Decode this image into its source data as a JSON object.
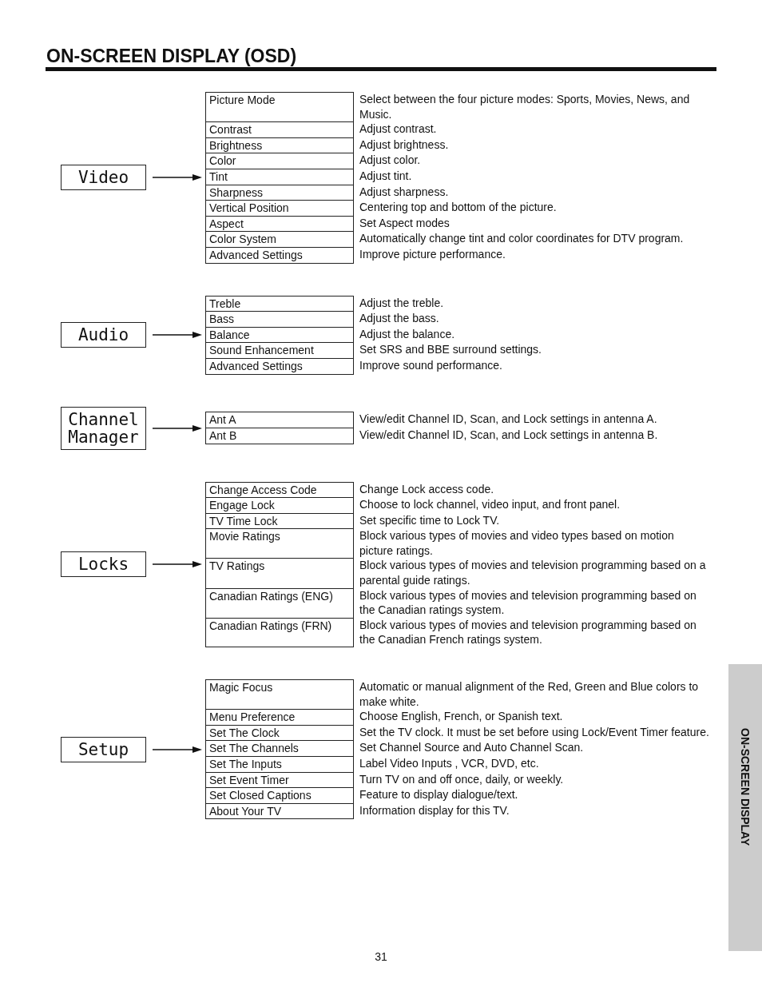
{
  "page_title": "ON-SCREEN DISPLAY (OSD)",
  "sections": [
    {
      "menu": "Video",
      "items": [
        {
          "name": "Picture Mode",
          "description": "Select between the four picture modes: Sports, Movies, News, and Music."
        },
        {
          "name": "Contrast",
          "description": "Adjust contrast."
        },
        {
          "name": "Brightness",
          "description": "Adjust brightness."
        },
        {
          "name": "Color",
          "description": "Adjust color."
        },
        {
          "name": "Tint",
          "description": "Adjust tint."
        },
        {
          "name": "Sharpness",
          "description": "Adjust sharpness."
        },
        {
          "name": "Vertical Position",
          "description": "Centering top and bottom of the picture."
        },
        {
          "name": "Aspect",
          "description": "Set Aspect modes"
        },
        {
          "name": "Color System",
          "description": "Automatically change tint and color coordinates for DTV program."
        },
        {
          "name": "Advanced Settings",
          "description": "Improve picture performance."
        }
      ]
    },
    {
      "menu": "Audio",
      "items": [
        {
          "name": "Treble",
          "description": "Adjust the treble."
        },
        {
          "name": "Bass",
          "description": "Adjust the bass."
        },
        {
          "name": "Balance",
          "description": "Adjust the balance."
        },
        {
          "name": "Sound Enhancement",
          "description": "Set SRS and BBE surround settings."
        },
        {
          "name": "Advanced Settings",
          "description": "Improve sound performance."
        }
      ]
    },
    {
      "menu": "Channel Manager",
      "items": [
        {
          "name": "Ant A",
          "description": "View/edit Channel ID, Scan, and Lock settings in antenna A."
        },
        {
          "name": "Ant B",
          "description": "View/edit Channel ID, Scan, and Lock settings in antenna B."
        }
      ]
    },
    {
      "menu": "Locks",
      "items": [
        {
          "name": "Change Access Code",
          "description": "Change Lock access code."
        },
        {
          "name": "Engage Lock",
          "description": "Choose to lock channel, video input, and front panel."
        },
        {
          "name": "TV Time Lock",
          "description": "Set specific time to Lock TV."
        },
        {
          "name": "Movie Ratings",
          "description": "Block various types of movies and video types based on motion picture ratings."
        },
        {
          "name": "TV Ratings",
          "description": "Block various types of movies and television programming based on a parental guide ratings."
        },
        {
          "name": "Canadian Ratings (ENG)",
          "description": "Block various types of movies and television programming based on the Canadian ratings system."
        },
        {
          "name": "Canadian Ratings (FRN)",
          "description": "Block various types of movies and television programming based on the Canadian French ratings system."
        }
      ]
    },
    {
      "menu": "Setup",
      "items": [
        {
          "name": "Magic Focus",
          "description": "Automatic or manual alignment of the Red, Green and Blue colors to make white."
        },
        {
          "name": "Menu Preference",
          "description": "Choose English, French, or Spanish text."
        },
        {
          "name": "Set The Clock",
          "description": "Set the TV clock. It must be set before using Lock/Event Timer feature."
        },
        {
          "name": "Set The Channels",
          "description": "Set Channel Source and Auto Channel Scan."
        },
        {
          "name": "Set The Inputs",
          "description": "Label Video Inputs , VCR, DVD, etc."
        },
        {
          "name": "Set Event Timer",
          "description": "Turn TV on and off once, daily, or weekly."
        },
        {
          "name": "Set Closed Captions",
          "description": "Feature to display dialogue/text."
        },
        {
          "name": "About Your TV",
          "description": "Information display for this TV."
        }
      ]
    }
  ],
  "side_tab": "ON-SCREEN DISPLAY",
  "page_number": "31"
}
